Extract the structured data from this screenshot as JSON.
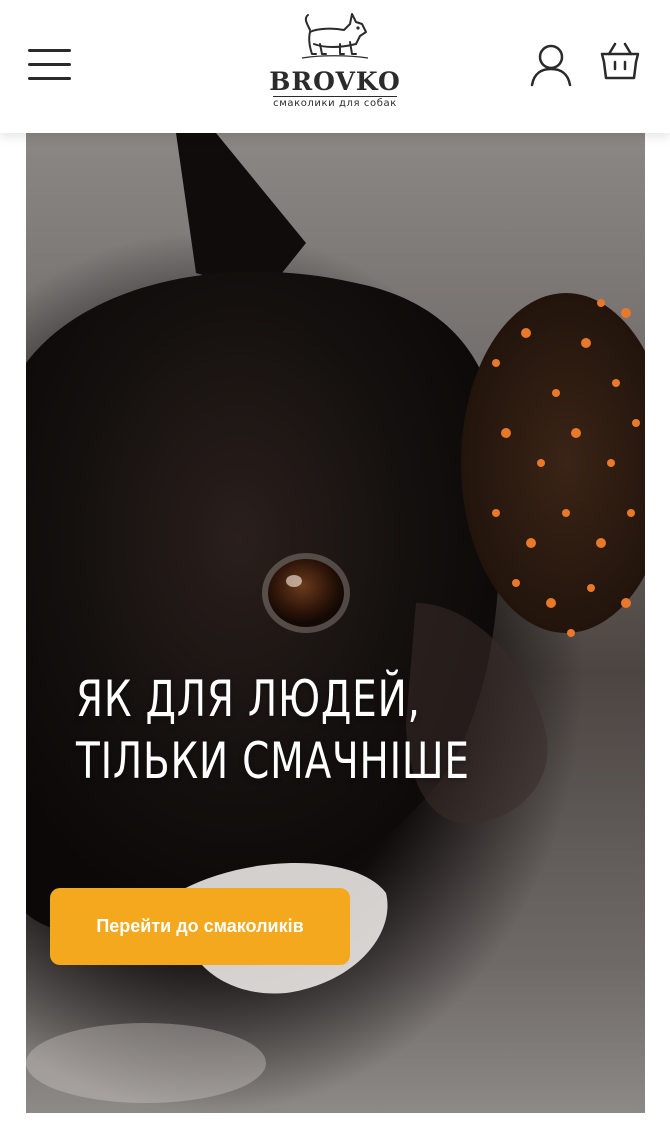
{
  "header": {
    "brand_name": "BROVKO",
    "brand_tagline": "смаколики для собак",
    "menu_icon": "hamburger-menu-icon",
    "account_icon": "user-icon",
    "cart_icon": "basket-icon"
  },
  "hero": {
    "title_line1": "ЯК ДЛЯ ЛЮДЕЙ,",
    "title_line2": "ТІЛЬКИ СМАЧНІШЕ",
    "cta_label": "Перейти до смаколиків",
    "image_subject": "french-bulldog-with-treat",
    "accent_color": "#f3a81d"
  }
}
